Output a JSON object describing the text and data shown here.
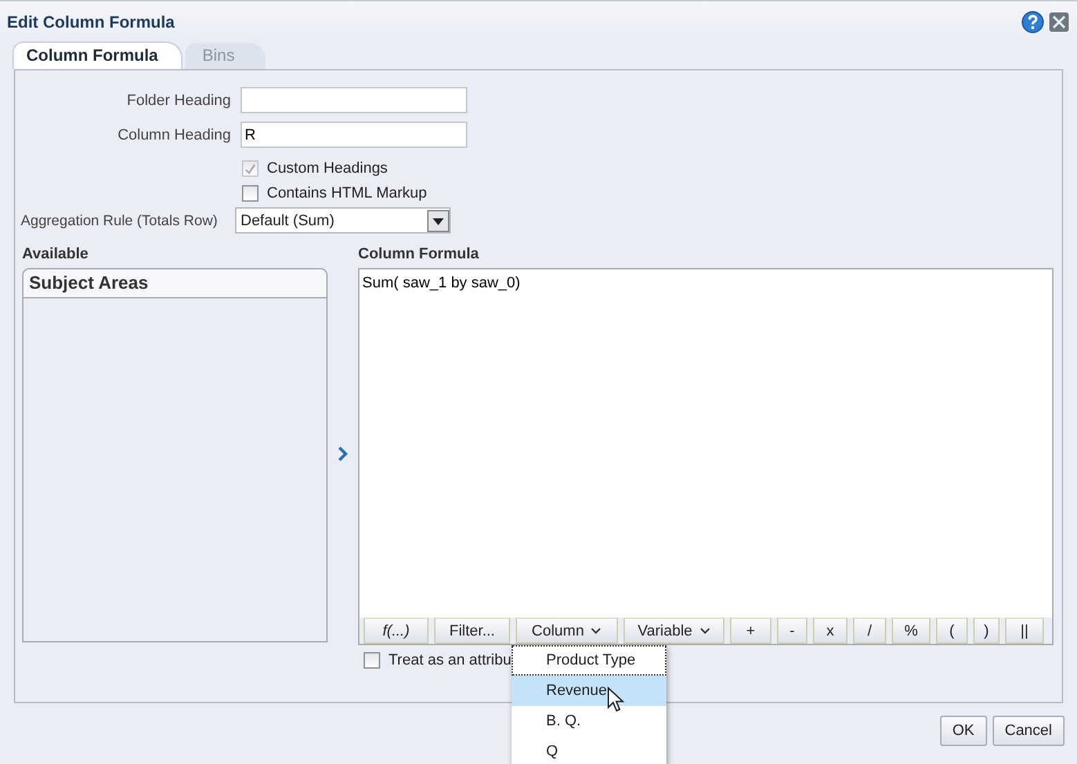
{
  "window": {
    "title": "Edit Column Formula"
  },
  "tabs": [
    {
      "label": "Column Formula",
      "selected": true
    },
    {
      "label": "Bins",
      "selected": false
    }
  ],
  "folder_heading": {
    "label": "Folder Heading"
  },
  "column_heading": {
    "label": "Column Heading",
    "value": "R"
  },
  "checkboxes": [
    {
      "label": "Custom Headings",
      "checked": true,
      "disabled": true
    },
    {
      "label": "Contains HTML Markup",
      "checked": false,
      "disabled": false
    }
  ],
  "aggregation_rule": {
    "label": "Aggregation Rule (Totals Row)",
    "value": "Default (Sum)"
  },
  "available": {
    "heading": "Available",
    "panel_title": "Subject Areas"
  },
  "column_formula": {
    "heading": "Column Formula",
    "value": "Sum( saw_1 by saw_0)"
  },
  "toolbar": [
    {
      "label": "f(...)",
      "kind": "function"
    },
    {
      "label": "Filter...",
      "kind": "plain"
    },
    {
      "label": "Column",
      "kind": "menu"
    },
    {
      "label": "Variable",
      "kind": "menu"
    },
    {
      "label": "+",
      "kind": "plain"
    },
    {
      "label": "-",
      "kind": "plain"
    },
    {
      "label": "x",
      "kind": "plain"
    },
    {
      "label": "/",
      "kind": "plain"
    },
    {
      "label": "%",
      "kind": "plain"
    },
    {
      "label": "(",
      "kind": "plain"
    },
    {
      "label": ")",
      "kind": "plain"
    },
    {
      "label": "||",
      "kind": "plain"
    }
  ],
  "treat_as_attribute": {
    "label": "Treat as an attribu",
    "checked": false
  },
  "column_menu": [
    {
      "label": "Product Type",
      "selected": false,
      "focused": true
    },
    {
      "label": "Revenue",
      "selected": true,
      "focused": false
    },
    {
      "label": "B. Q.",
      "selected": false,
      "focused": false
    },
    {
      "label": "Q",
      "selected": false,
      "focused": false
    }
  ],
  "buttons": [
    "OK",
    "Cancel"
  ]
}
